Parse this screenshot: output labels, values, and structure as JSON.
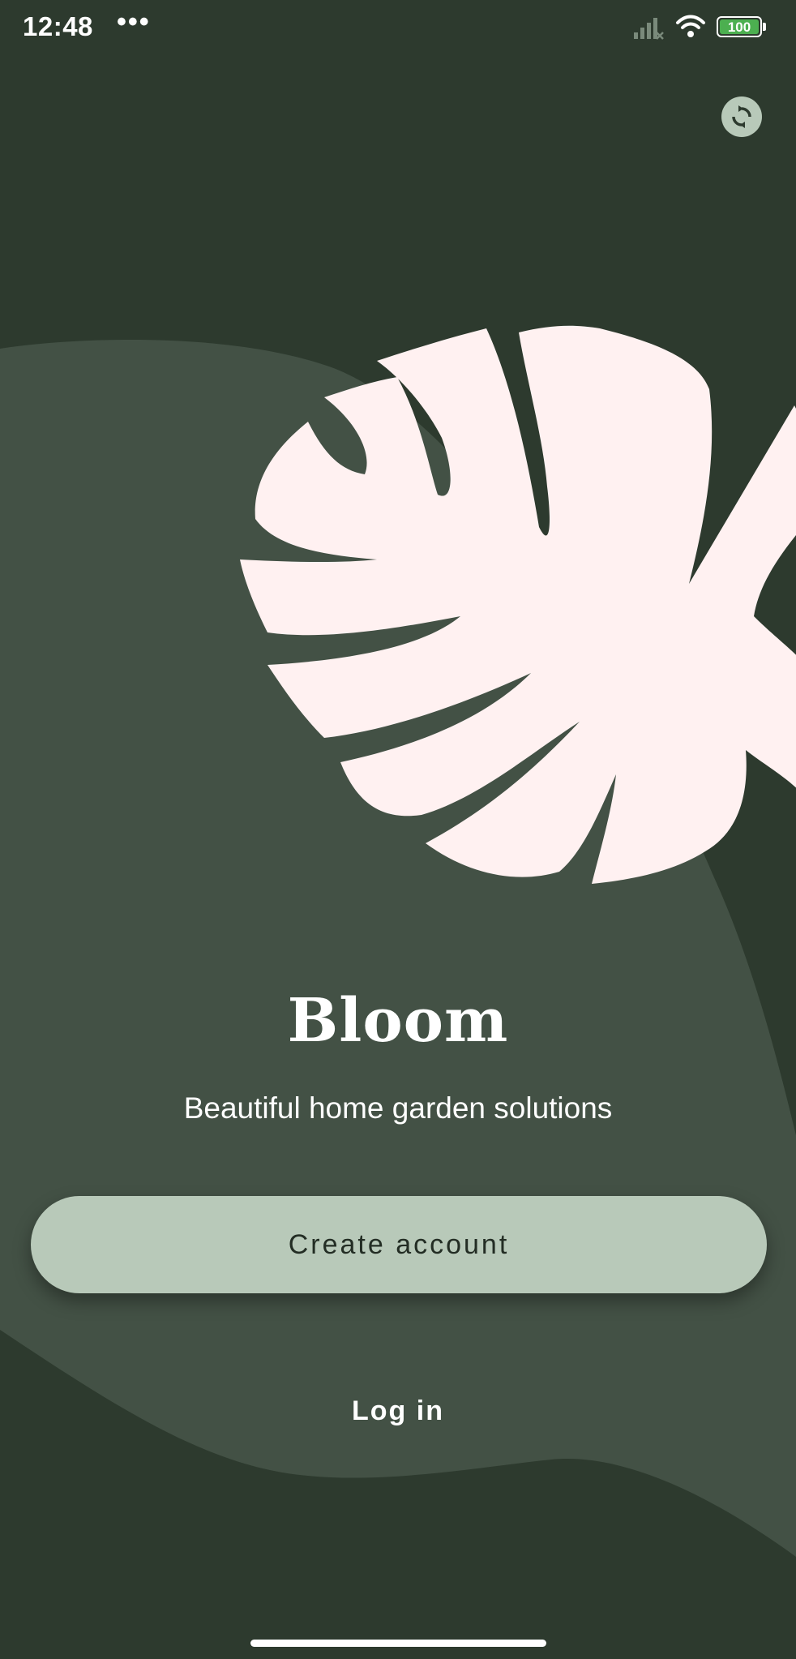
{
  "status_bar": {
    "time": "12:48",
    "more": "•••",
    "battery": "100",
    "icons": [
      "signal-icon",
      "wifi-icon",
      "battery-icon"
    ]
  },
  "toolbar": {
    "theme_toggle_icon": "sync-icon"
  },
  "hero": {
    "illustration": "monstera-leaf-illustration",
    "title": "Bloom",
    "subtitle": "Beautiful home garden solutions"
  },
  "actions": {
    "create_account_label": "Create account",
    "login_label": "Log in"
  },
  "colors": {
    "background": "#2d3a2e",
    "blob": "#435145",
    "leaf": "#fff1f1",
    "button": "#b8c9b9",
    "button_text": "#232d24",
    "text": "#ffffff"
  }
}
